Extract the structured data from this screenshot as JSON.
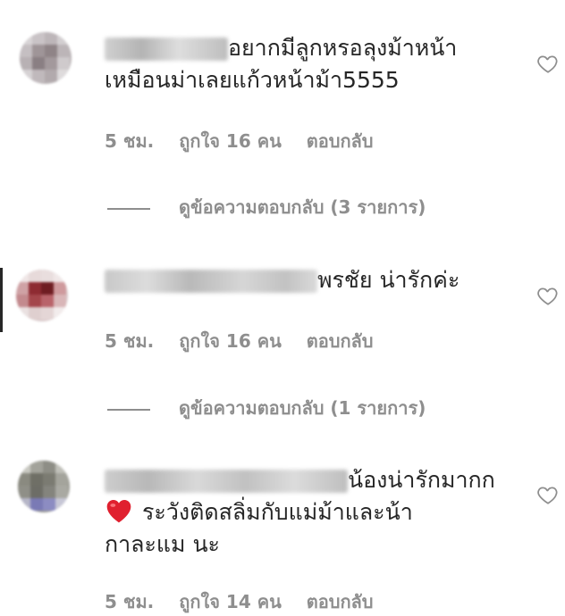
{
  "comments": [
    {
      "text_line1": "อยากมีลูกหรอลุงม้าหน้า",
      "text_line2": "เหมือนม่าเลยแก้วหน้าม้า5555",
      "time": "5 ชม.",
      "likes": "ถูกใจ 16 คน",
      "reply": "ตอบกลับ",
      "view_replies": "ดูข้อความตอบกลับ (3 รายการ)"
    },
    {
      "text_line1": "พรชัย น่ารักค่ะ",
      "time": "5 ชม.",
      "likes": "ถูกใจ 16 คน",
      "reply": "ตอบกลับ",
      "view_replies": "ดูข้อความตอบกลับ (1 รายการ)"
    },
    {
      "text_line1": "น้องน่ารักมากก",
      "text_line2": "ระวังติดสลิ่มกับแม่ม้าและน้า",
      "text_line3": "กาละแม นะ",
      "time": "5 ชม.",
      "likes": "ถูกใจ 14 คน",
      "reply": "ตอบกลับ"
    }
  ],
  "icons": {
    "like": "heart-outline-icon",
    "emoji": "red-heart-emoji"
  },
  "colors": {
    "text": "#262626",
    "meta": "#8e8e8e",
    "emoji_heart": "#e0202f"
  }
}
